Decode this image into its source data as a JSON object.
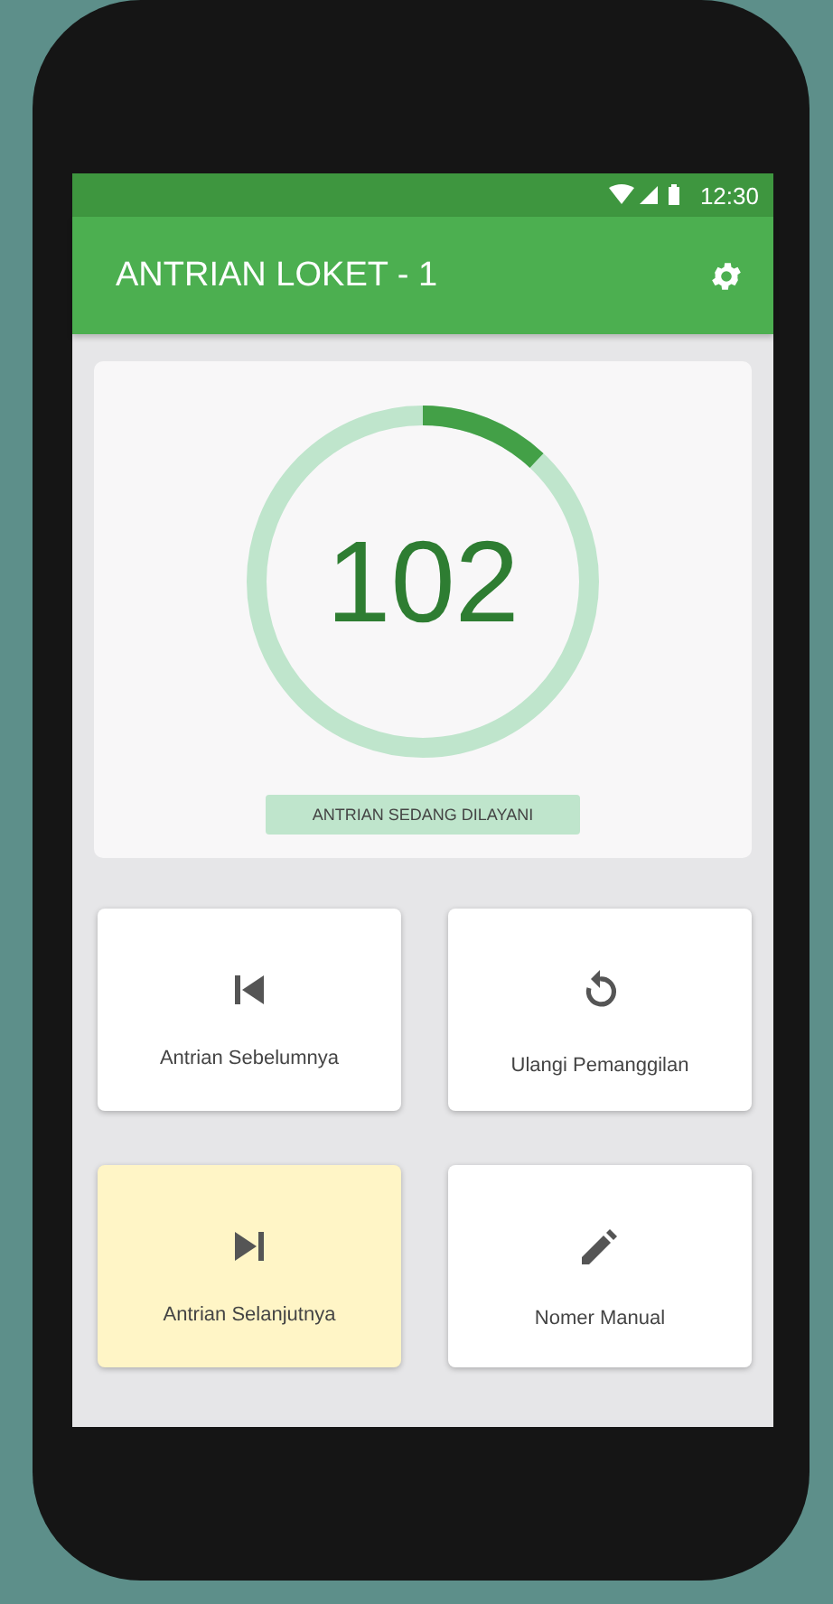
{
  "status_bar": {
    "time": "12:30"
  },
  "app_bar": {
    "title": "ANTRIAN LOKET - 1"
  },
  "queue": {
    "number": "102",
    "level": 0.12,
    "label": "ANTRIAN SEDANG DILAYANI"
  },
  "buttons": [
    {
      "kind": "previous",
      "label": "Antrian Sebelumnya",
      "selected": false
    },
    {
      "kind": "replay",
      "label": "Ulangi Pemanggilan",
      "selected": false
    },
    {
      "kind": "next",
      "label": "Antrian Selanjutnya",
      "selected": true
    },
    {
      "kind": "edit",
      "label": "Nomer Manual",
      "selected": false
    }
  ]
}
